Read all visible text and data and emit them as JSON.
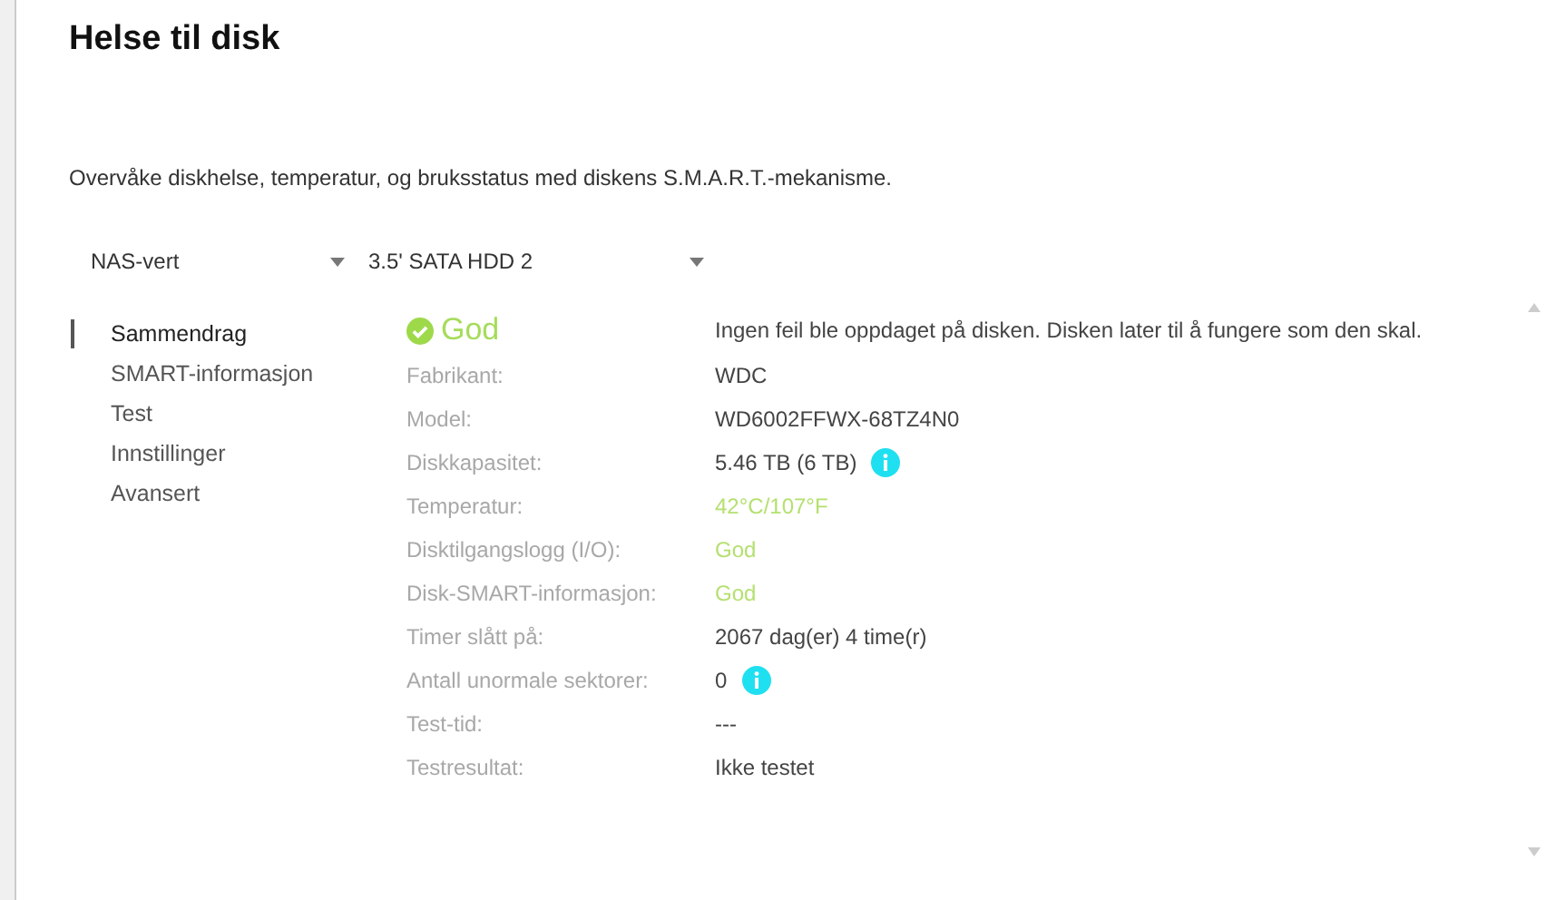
{
  "title": "Helse til disk",
  "description": "Overvåke diskhelse, temperatur, og bruksstatus med diskens S.M.A.R.T.-mekanisme.",
  "dropdowns": [
    {
      "value": "NAS-vert"
    },
    {
      "value": "3.5' SATA HDD 2"
    }
  ],
  "nav": [
    {
      "label": "Sammendrag",
      "selected": true
    },
    {
      "label": "SMART-informasjon",
      "selected": false
    },
    {
      "label": "Test",
      "selected": false
    },
    {
      "label": "Innstillinger",
      "selected": false
    },
    {
      "label": "Avansert",
      "selected": false
    }
  ],
  "status": {
    "label": "God",
    "message": "Ingen feil ble oppdaget på disken. Disken later til å fungere som den skal."
  },
  "rows": [
    {
      "label": "Fabrikant:",
      "value": "WDC",
      "good": false,
      "info": false
    },
    {
      "label": "Model:",
      "value": "WD6002FFWX-68TZ4N0",
      "good": false,
      "info": false
    },
    {
      "label": "Diskkapasitet:",
      "value": "5.46 TB (6 TB)",
      "good": false,
      "info": true
    },
    {
      "label": "Temperatur:",
      "value": "42°C/107°F",
      "good": true,
      "info": false
    },
    {
      "label": "Disktilgangslogg (I/O):",
      "value": "God",
      "good": true,
      "info": false
    },
    {
      "label": "Disk-SMART-informasjon:",
      "value": "God",
      "good": true,
      "info": false
    },
    {
      "label": "Timer slått på:",
      "value": "2067 dag(er) 4 time(r)",
      "good": false,
      "info": false
    },
    {
      "label": "Antall unormale sektorer:",
      "value": "0",
      "good": false,
      "info": true
    },
    {
      "label": "Test-tid:",
      "value": "---",
      "good": false,
      "info": false
    },
    {
      "label": "Testresultat:",
      "value": "Ikke testet",
      "good": false,
      "info": false
    }
  ]
}
